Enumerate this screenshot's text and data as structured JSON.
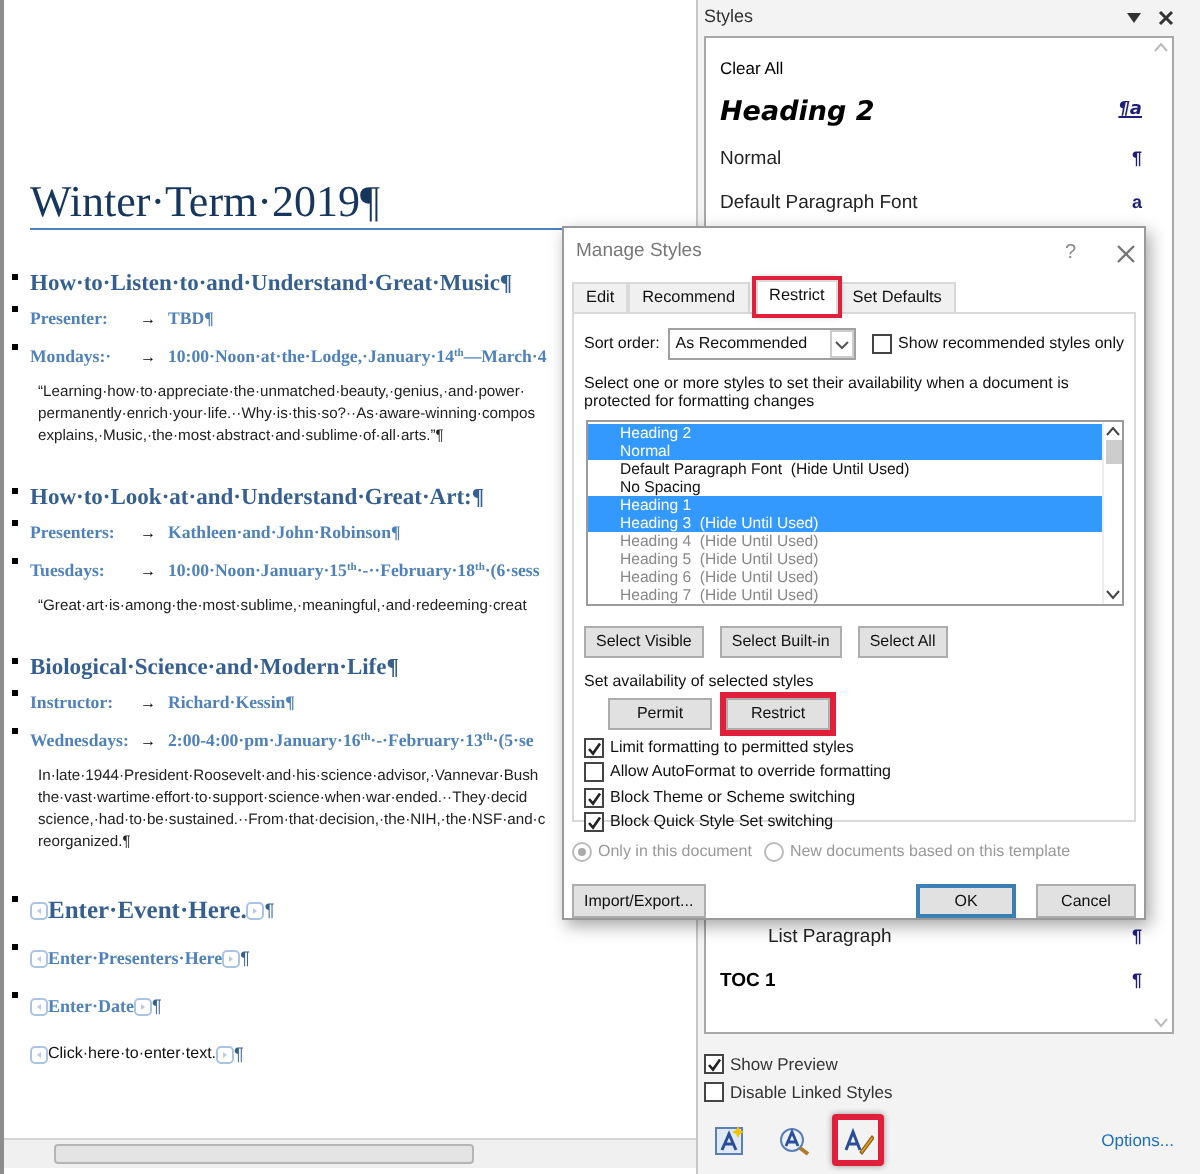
{
  "document": {
    "title": "Winter·Term·2019¶",
    "sections": [
      {
        "heading": "How·to·Listen·to·and·Understand·Great·Music¶",
        "details": [
          {
            "label": "Presenter:",
            "arrow": "→",
            "value": "TBD¶"
          },
          {
            "label": "Mondays:·",
            "arrow": "→",
            "value": "10:00·Noon·at·the·Lodge,·January·14$^{th}$—March·4"
          }
        ],
        "description": [
          "“Learning·how·to·appreciate·the·unmatched·beauty,·genius,·and·power·",
          "permanently·enrich·your·life.··Why·is·this·so?··As·aware-winning·compos",
          "explains,·Music,·the·most·abstract·and·sublime·of·all·arts.”¶"
        ]
      },
      {
        "heading": "How·to·Look·at·and·Understand·Great·Art:¶",
        "details": [
          {
            "label": "Presenters:",
            "arrow": "→",
            "value": "Kathleen·and·John·Robinson¶"
          },
          {
            "label": "Tuesdays:",
            "arrow": "→",
            "value": "10:00·Noon·January·15$^{th}$·-··February·18$^{th}$·(6·sess"
          }
        ],
        "description": [
          "“Great·art·is·among·the·most·sublime,·meaningful,·and·redeeming·creat"
        ]
      },
      {
        "heading": "Biological·Science·and·Modern·Life¶",
        "details": [
          {
            "label": "Instructor:",
            "arrow": "→",
            "value": "Richard·Kessin¶"
          },
          {
            "label": "Wednesdays:",
            "arrow": "→",
            "value": "2:00-4:00·pm·January·16$^{th}$·-·February·13$^{th}$·(5·se"
          }
        ],
        "description": [
          "In·late·1944·President·Roosevelt·and·his·science·advisor,·Vannevar·Bush",
          "the·vast·wartime·effort·to·support·science·when·war·ended.··They·decid",
          "science,·had·to·be·sustained.··From·that·decision,·the·NIH,·the·NSF·and·c",
          "reorganized.¶"
        ]
      }
    ],
    "placeholders": [
      {
        "kind": "heading",
        "text": "Enter·Event·Here.",
        "mark": "¶"
      },
      {
        "kind": "detail",
        "text": "Enter·Presenters·Here",
        "mark": "¶"
      },
      {
        "kind": "detail",
        "text": "Enter·Date",
        "mark": "¶"
      },
      {
        "kind": "body",
        "text": "Click·here·to·enter·text.",
        "mark": "¶"
      }
    ]
  },
  "styles_pane": {
    "title": "Styles",
    "items": [
      {
        "kind": "small",
        "name": "Clear All"
      },
      {
        "kind": "heading",
        "name": "Heading 2",
        "mark": "¶a"
      },
      {
        "kind": "normal",
        "name": "Normal",
        "mark": "¶"
      },
      {
        "kind": "normal",
        "name": "Default Paragraph Font",
        "mark": "a"
      },
      {
        "kind": "indented",
        "name": "List Paragraph",
        "mark": "¶"
      },
      {
        "kind": "bold",
        "name": "TOC 1",
        "mark": "¶"
      }
    ],
    "options": [
      {
        "label": "Show Preview",
        "checked": true
      },
      {
        "label": "Disable Linked Styles",
        "checked": false
      }
    ],
    "tools": [
      {
        "kind": "new-style",
        "highlighted": false
      },
      {
        "kind": "inspector",
        "highlighted": false
      },
      {
        "kind": "manage",
        "highlighted": true
      }
    ],
    "options_link": "Options..."
  },
  "dialog": {
    "title": "Manage Styles",
    "help": "?",
    "tabs": [
      {
        "label": "Edit",
        "selected": false,
        "highlighted": false
      },
      {
        "label": "Recommend",
        "selected": false,
        "highlighted": false
      },
      {
        "label": "Restrict",
        "selected": true,
        "highlighted": true
      },
      {
        "label": "Set Defaults",
        "selected": false,
        "highlighted": false
      }
    ],
    "sort_label": "Sort order:",
    "sort_value": "As Recommended",
    "show_recommended": {
      "label": "Show recommended styles only",
      "checked": false
    },
    "instructions": "Select one or more styles to set their availability when a document is protected for formatting changes",
    "style_list": [
      {
        "name": "Heading 2",
        "selected": true,
        "restricted": false
      },
      {
        "name": "Normal",
        "selected": true,
        "restricted": false
      },
      {
        "name": "Default Paragraph Font  (Hide Until Used)",
        "selected": false,
        "restricted": false
      },
      {
        "name": "No Spacing",
        "selected": false,
        "restricted": false
      },
      {
        "name": "Heading 1",
        "selected": true,
        "restricted": false
      },
      {
        "name": "Heading 3  (Hide Until Used)",
        "selected": true,
        "restricted": false
      },
      {
        "name": "Heading 4  (Hide Until Used)",
        "selected": false,
        "restricted": true
      },
      {
        "name": "Heading 5  (Hide Until Used)",
        "selected": false,
        "restricted": true
      },
      {
        "name": "Heading 6  (Hide Until Used)",
        "selected": false,
        "restricted": true
      },
      {
        "name": "Heading 7  (Hide Until Used)",
        "selected": false,
        "restricted": true
      }
    ],
    "select_buttons": [
      {
        "label": "Select Visible"
      },
      {
        "label": "Select Built-in"
      },
      {
        "label": "Select All"
      }
    ],
    "availability_label": "Set availability of selected styles",
    "availability_buttons": [
      {
        "label": "Permit",
        "highlighted": false
      },
      {
        "label": "Restrict",
        "highlighted": true
      }
    ],
    "options": [
      {
        "label": "Limit formatting to permitted styles",
        "checked": true
      },
      {
        "label": "Allow AutoFormat to override formatting",
        "checked": false
      },
      {
        "label": "Block Theme or Scheme switching",
        "checked": true
      },
      {
        "label": "Block Quick Style Set switching",
        "checked": true
      }
    ],
    "scope_disabled": true,
    "scope": [
      {
        "label": "Only in this document",
        "selected": true
      },
      {
        "label": "New documents based on this template",
        "selected": false
      }
    ],
    "footer_buttons": [
      {
        "label": "Import/Export...",
        "default": false
      },
      {
        "label": "OK",
        "default": true
      },
      {
        "label": "Cancel",
        "default": false
      }
    ]
  }
}
